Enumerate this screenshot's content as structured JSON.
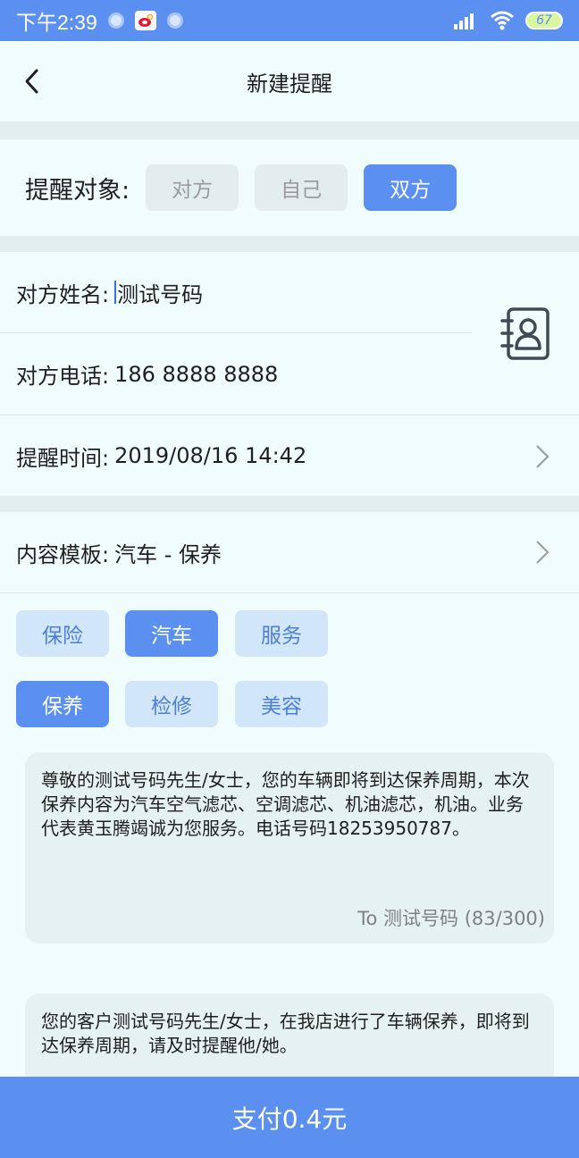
{
  "status_bar": {
    "time": "下午2:39",
    "battery": "67"
  },
  "nav": {
    "title": "新建提醒"
  },
  "target": {
    "label": "提醒对象:",
    "options": [
      "对方",
      "自己",
      "双方"
    ],
    "selected": "双方"
  },
  "form": {
    "name_label": "对方姓名:",
    "name_value": "测试号码",
    "phone_label": "对方电话:",
    "phone_value": "186 8888 8888",
    "time_label": "提醒时间:",
    "time_value": "2019/08/16 14:42",
    "template_label": "内容模板:",
    "template_value": "汽车 - 保养"
  },
  "categories": {
    "items": [
      "保险",
      "汽车",
      "服务"
    ],
    "selected": "汽车"
  },
  "subcategories": {
    "items": [
      "保养",
      "检修",
      "美容"
    ],
    "selected": "保养"
  },
  "message_customer": {
    "text": "尊敬的测试号码先生/女士，您的车辆即将到达保养周期，本次保养内容为汽车空气滤芯、空调滤芯、机油滤芯，机油。业务代表黄玉腾竭诚为您服务。电话号码18253950787。",
    "counter": "To 测试号码 (83/300)"
  },
  "message_self": {
    "text": "您的客户测试号码先生/女士，在我店进行了车辆保养，即将到达保养周期，请及时提醒他/她。"
  },
  "pay": {
    "label": "支付0.4元"
  },
  "colors": {
    "accent": "#5b8ff0",
    "tag_light": "#d1e6f8",
    "background": "#f1fcfc"
  }
}
